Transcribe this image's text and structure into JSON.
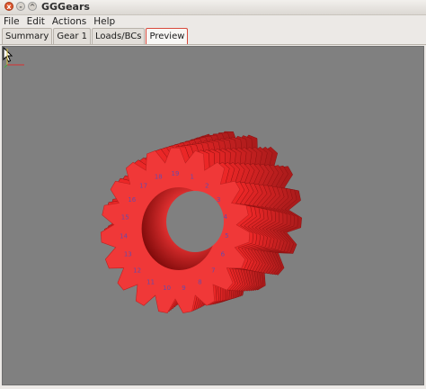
{
  "window": {
    "title": "GGGears"
  },
  "window_buttons": {
    "close": "x",
    "minimize": "-",
    "maximize": "^"
  },
  "menu": [
    "File",
    "Edit",
    "Actions",
    "Help"
  ],
  "tabs": [
    {
      "label": "Summary",
      "active": false
    },
    {
      "label": "Gear 1",
      "active": false
    },
    {
      "label": "Loads/BCs",
      "active": false
    },
    {
      "label": "Preview",
      "active": true
    }
  ],
  "preview": {
    "gear_color": "#f03838",
    "background_color": "#808080",
    "label_color": "#6a4aa8",
    "tooth_labels": [
      "1",
      "2",
      "3",
      "4",
      "5",
      "6",
      "7",
      "8",
      "9",
      "10",
      "11",
      "12",
      "13",
      "14",
      "15",
      "16",
      "17",
      "18",
      "19"
    ]
  }
}
